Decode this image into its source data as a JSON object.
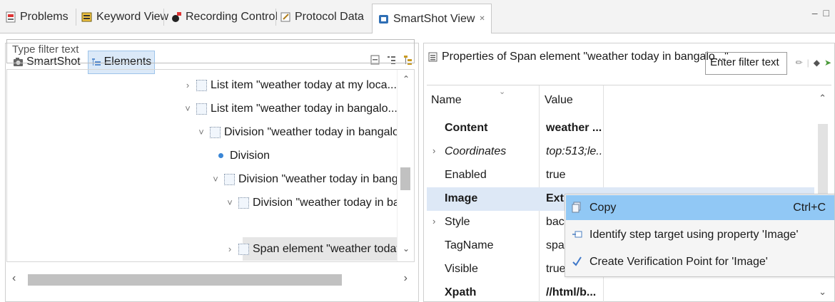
{
  "tabs": [
    {
      "label": "Problems",
      "icon": "problems-icon"
    },
    {
      "label": "Keyword View",
      "icon": "keyword-view-icon"
    },
    {
      "label": "Recording Control",
      "icon": "recording-icon"
    },
    {
      "label": "Protocol Data",
      "icon": "protocol-icon"
    },
    {
      "label": "SmartShot View",
      "icon": "smartshot-view-icon",
      "close": "✕"
    }
  ],
  "window_controls": {
    "minimize": "–",
    "maximize": "□"
  },
  "left": {
    "toolbar": {
      "smartshot_label": "SmartShot",
      "elements_label": "Elements"
    },
    "filter_placeholder": "Type filter text",
    "tree": [
      {
        "chevron": "›",
        "label": "List item \"weather today at my loca...\""
      },
      {
        "chevron": "˅",
        "label": "List item \"weather today in bangalo...\""
      },
      {
        "chevron": "˅",
        "label": "Division \"weather today in bangalo...\""
      },
      {
        "chevron": "",
        "label": "Division"
      },
      {
        "chevron": "˅",
        "label": "Division \"weather today in bangalo"
      },
      {
        "chevron": "˅",
        "label": "Division \"weather today in bang"
      },
      {
        "chevron": "›",
        "label": "Span element \"weather today"
      }
    ],
    "scroll": {
      "left": "‹",
      "right": "›"
    }
  },
  "right": {
    "title": "Properties of Span element \"weather today in bangalo...\"",
    "filter_placeholder": "Enter filter text",
    "columns": {
      "name": "Name",
      "value": "Value"
    },
    "rows": [
      {
        "name": "Content",
        "value": "weather ...",
        "bold": true
      },
      {
        "name": "Coordinates",
        "value": "top:513;le...",
        "italic": true,
        "expand": "›"
      },
      {
        "name": "Enabled",
        "value": "true"
      },
      {
        "name": "Image",
        "value": "Extract",
        "bold": true
      },
      {
        "name": "Style",
        "value": "back",
        "expand": "›"
      },
      {
        "name": "TagName",
        "value": "span"
      },
      {
        "name": "Visible",
        "value": "true"
      },
      {
        "name": "Xpath",
        "value": "//html/b...",
        "bold": true
      }
    ]
  },
  "context_menu": [
    {
      "label": "Copy",
      "shortcut": "Ctrl+C",
      "icon": "copy-icon"
    },
    {
      "label": "Identify step target using property 'Image'",
      "shortcut": "",
      "icon": "target-icon"
    },
    {
      "label": "Create Verification Point for 'Image'",
      "shortcut": "",
      "icon": "checkmark-icon"
    }
  ],
  "colors": {
    "menu_highlight": "#91c8f5",
    "selection": "#dbe9f8",
    "accent": "#3a86d6"
  }
}
